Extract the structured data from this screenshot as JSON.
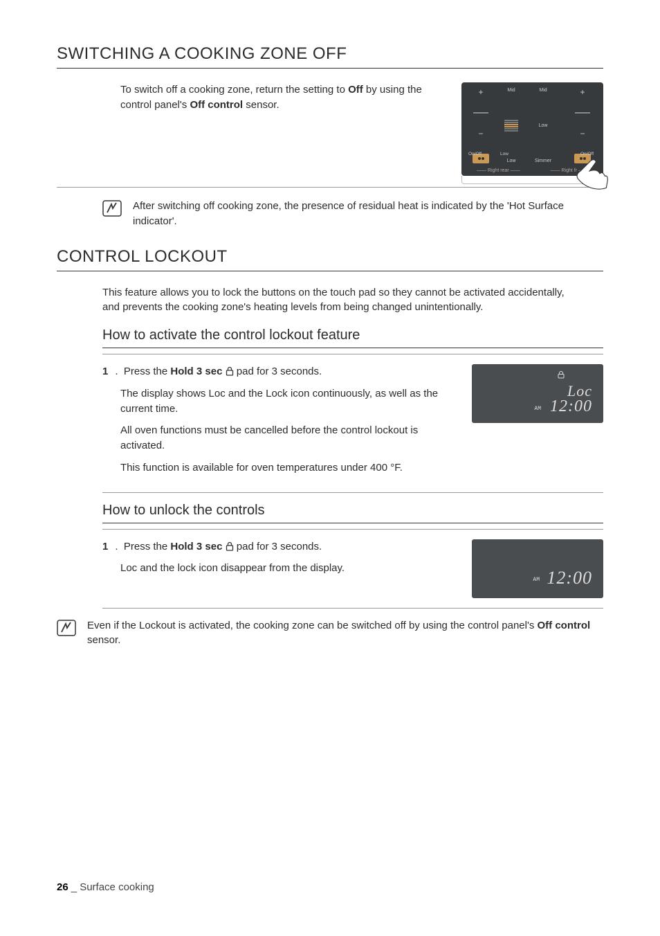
{
  "section1": {
    "title": "SWITCHING A COOKING ZONE OFF",
    "para_pre": "To switch off a cooking zone, return the setting to ",
    "para_bold1": "Off",
    "para_mid": " by using the control panel's ",
    "para_bold2": "Off control",
    "para_post": " sensor."
  },
  "panel": {
    "mid": "Mid",
    "low": "Low",
    "onoff": "On/Off",
    "simmer": "Simmer",
    "right_rear": "Right rear",
    "right_front": "Right fr"
  },
  "note1": {
    "text": "After switching off cooking zone, the presence of residual heat is indicated by the 'Hot Surface indicator'."
  },
  "section2": {
    "title": "CONTROL LOCKOUT",
    "intro": "This feature allows you to lock the buttons on the touch pad so they cannot be activated accidentally, and prevents the cooking zone's heating levels from being changed unintentionally.",
    "sub1": "How to activate the control lockout feature",
    "sub2": "How to unlock the controls"
  },
  "activate": {
    "num": "1",
    "press_pre": "Press the ",
    "press_bold": "Hold 3 sec",
    "press_post": " pad for 3 seconds.",
    "line2": "The display shows Loc and the Lock icon continuously, as well as the current time.",
    "line3": "All oven functions must be cancelled before the control lockout is activated.",
    "line4": "This function is available for oven temperatures under 400 °F."
  },
  "display": {
    "loc": "Loc",
    "time": "12:00",
    "am": "AM"
  },
  "unlock": {
    "num": "1",
    "press_pre": "Press the ",
    "press_bold": "Hold 3 sec",
    "press_post": " pad for 3 seconds.",
    "line2": "Loc and the lock icon disappear from the display."
  },
  "note2": {
    "pre": "Even if the Lockout is activated, the cooking zone can be switched off by using the control panel's ",
    "bold": "Off control",
    "post": " sensor."
  },
  "footer": {
    "page": "26",
    "chapter": "Surface cooking"
  }
}
